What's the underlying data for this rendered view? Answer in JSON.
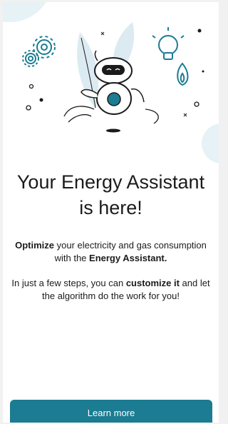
{
  "onboarding": {
    "title_line1": "Your Energy Assistant",
    "title_line2": "is here!",
    "paragraph1": {
      "bold1": "Optimize",
      "text1": " your electricity and gas consumption with the ",
      "bold2": "Energy Assistant."
    },
    "paragraph2": {
      "text1": "In just a few steps, you can ",
      "bold1": "customize it",
      "text2": " and let the algorithm do the work for you!"
    },
    "cta_label": "Learn more"
  },
  "colors": {
    "accent": "#1b7c92",
    "illustration_fill": "#dcebf2",
    "text": "#1b1b1b"
  },
  "illustration": {
    "icons": [
      "robot-icon",
      "gear-icon",
      "lightbulb-icon",
      "flame-icon",
      "leaf-icon"
    ]
  }
}
